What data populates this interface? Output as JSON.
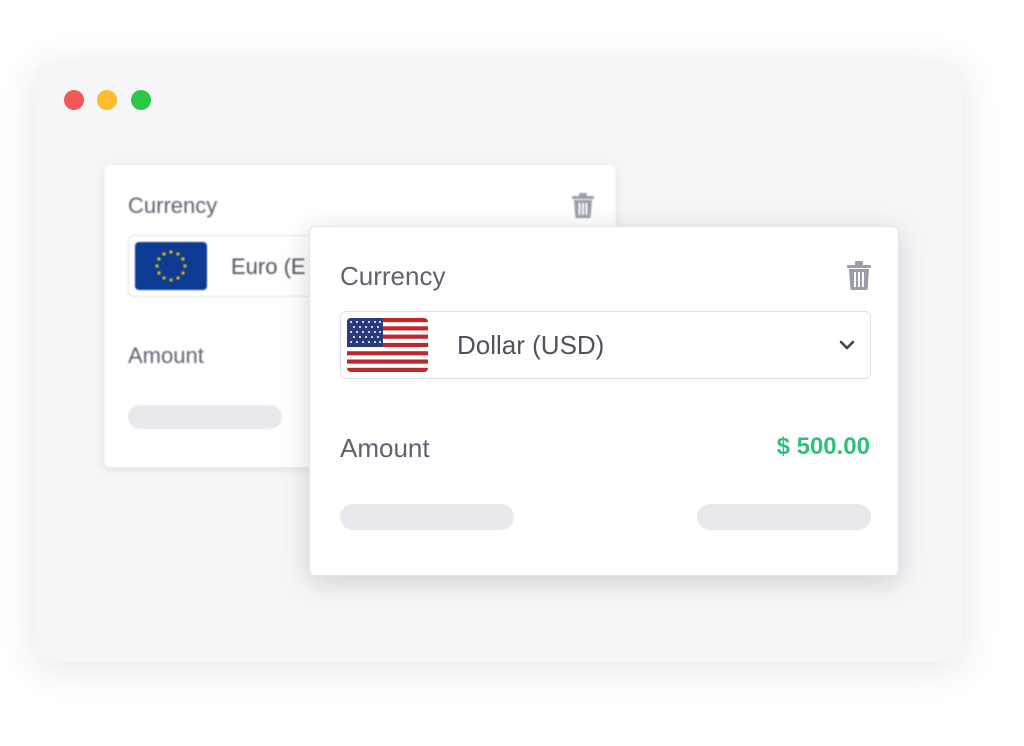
{
  "window": {
    "controls": [
      "close",
      "minimize",
      "maximize"
    ]
  },
  "back_card": {
    "currency_label": "Currency",
    "selected_currency": "Euro (E",
    "flag_icon": "eu-flag-icon",
    "amount_label": "Amount",
    "delete_icon": "trash-icon"
  },
  "front_card": {
    "currency_label": "Currency",
    "selected_currency": "Dollar (USD)",
    "flag_icon": "us-flag-icon",
    "dropdown_icon": "chevron-down-icon",
    "amount_label": "Amount",
    "amount_value": "$ 500.00",
    "delete_icon": "trash-icon"
  },
  "colors": {
    "accent_green": "#2ec27e",
    "window_bg": "#f6f6f8",
    "close": "#f25856",
    "minimize": "#fbbc2e",
    "maximize": "#2dc845"
  }
}
